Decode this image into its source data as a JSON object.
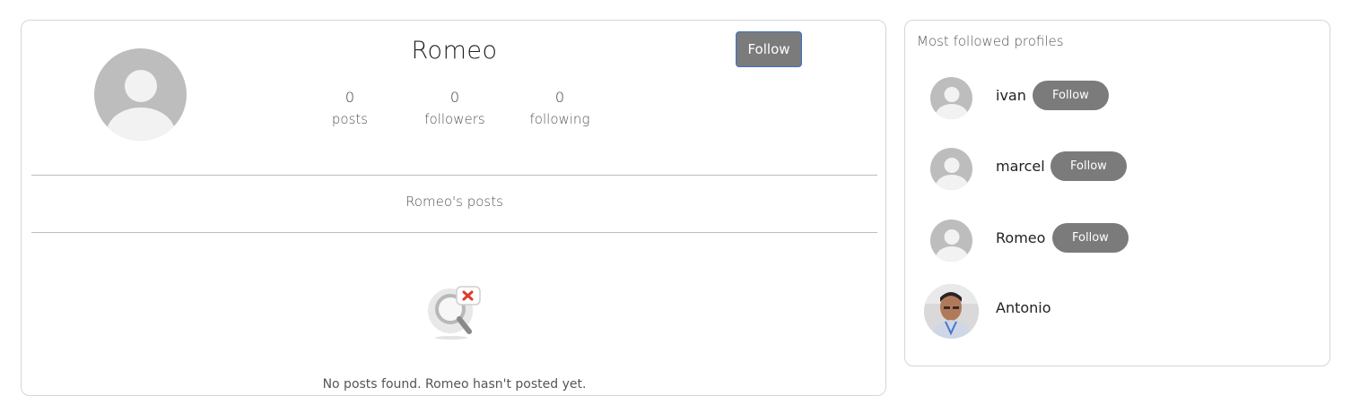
{
  "profile": {
    "name": "Romeo",
    "follow_label": "Follow",
    "stats": [
      {
        "value": "0",
        "label": "posts"
      },
      {
        "value": "0",
        "label": "followers"
      },
      {
        "value": "0",
        "label": "following"
      }
    ],
    "posts_heading": "Romeo's posts",
    "empty_text": "No posts found. Romeo hasn't posted yet.",
    "empty_icon": "search-no-results-icon"
  },
  "sidebar": {
    "title": "Most followed profiles",
    "profiles": [
      {
        "name": "ivan",
        "follow_label": "Follow",
        "avatar": "default-avatar-icon"
      },
      {
        "name": "marcel",
        "follow_label": "Follow",
        "avatar": "default-avatar-icon"
      },
      {
        "name": "Romeo",
        "follow_label": "Follow",
        "avatar": "default-avatar-icon"
      },
      {
        "name": "Antonio",
        "avatar": "user-photo"
      }
    ]
  },
  "colors": {
    "button_bg": "#7b7b7b",
    "button_focus_border": "#3b6fd1",
    "avatar_bg": "#bdbdbd",
    "card_border": "#d6d6d6"
  }
}
